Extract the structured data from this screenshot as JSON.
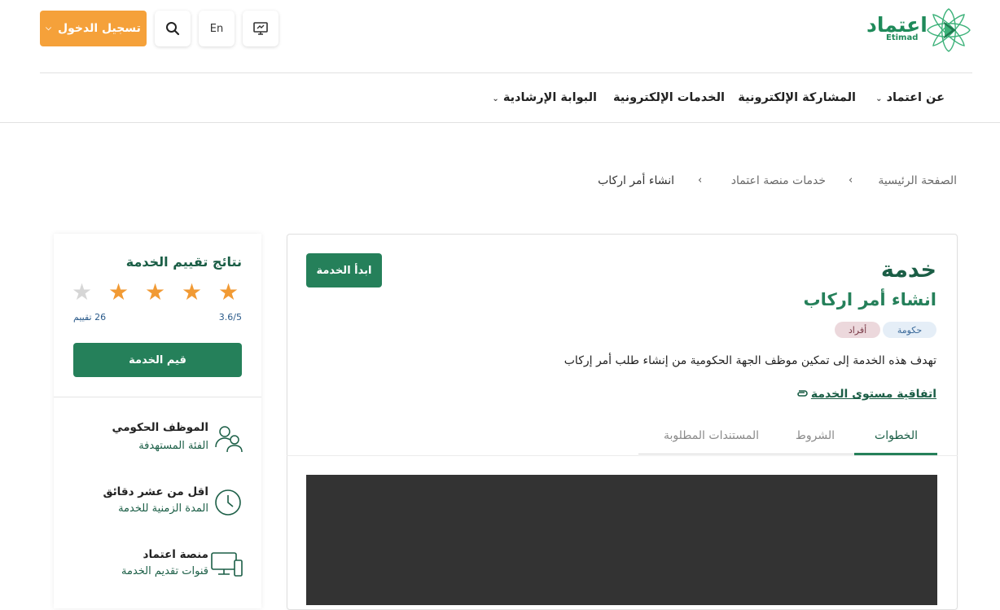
{
  "header": {
    "logo": {
      "ar": "اعتماد",
      "en": "Etimad"
    },
    "login_label": "تسجيل الدخول",
    "lang_label": "En",
    "icons": [
      "screen-icon",
      "search-icon"
    ]
  },
  "nav": {
    "items": [
      {
        "label": "عن اعتماد",
        "has_caret": true
      },
      {
        "label": "المشاركة الإلكترونية",
        "has_caret": false
      },
      {
        "label": "الخدمات الإلكترونية",
        "has_caret": false
      },
      {
        "label": "البوابة الإرشادية",
        "has_caret": true
      }
    ]
  },
  "breadcrumb": [
    "الصفحة الرئيسية",
    "خدمات منصة اعتماد",
    "انشاء أمر اركاب"
  ],
  "service": {
    "label": "خدمة",
    "name": "انشاء أمر اركاب",
    "start_label": "ابدأ الخدمة",
    "tags": [
      "حكومة",
      "أفراد"
    ],
    "description": "تهدف هذه الخدمة إلى تمكين موظف الجهة الحكومية من إنشاء طلب أمر إركاب",
    "sla_link": "اتفاقية مستوى الخدمة",
    "tabs": [
      "الخطوات",
      "الشروط",
      "المستندات المطلوبة"
    ],
    "active_tab": "الخطوات"
  },
  "rating": {
    "title": "نتائج تقييم الخدمة",
    "stars_filled": 4,
    "stars_total": 5,
    "score": "3.6/5",
    "count": "26 تقييم",
    "rate_label": "قيم الخدمة"
  },
  "info": [
    {
      "title": "الموظف الحكومي",
      "subtitle": "الفئة المستهدفة",
      "icon": "users-icon"
    },
    {
      "title": "اقل من عشر دقائق",
      "subtitle": "المدة الزمنية للخدمة",
      "icon": "clock-icon"
    },
    {
      "title": "منصة اعتماد",
      "subtitle": "قنوات تقديم الخدمة",
      "icon": "devices-icon"
    }
  ],
  "colors": {
    "primary": "#25805a",
    "accent": "#f5a13a",
    "dark_green": "#1b5e46"
  }
}
